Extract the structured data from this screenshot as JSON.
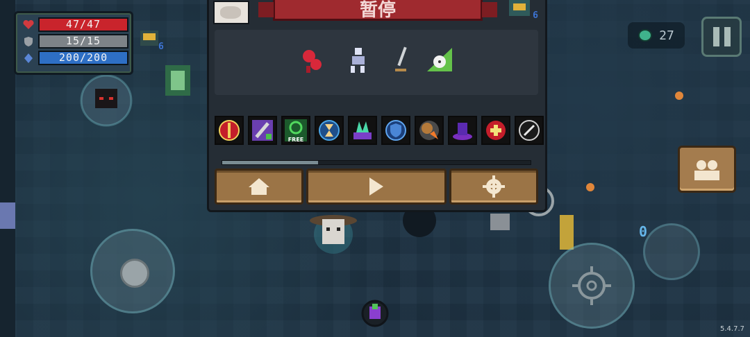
{
  "player": {
    "hp": "47/47",
    "armor": "15/15",
    "energy": "200/200",
    "hp_fraction": 1.0,
    "armor_fraction": 1.0,
    "energy_fraction": 1.0
  },
  "colors": {
    "hp": "#c9242c",
    "armor": "#7d8388",
    "energy": "#2e6fc5",
    "menu_bg": "#252d35",
    "banner": "#9f2a2f",
    "button": "#9b7446"
  },
  "gems": {
    "count": "27",
    "icon": "gem-icon"
  },
  "pause_menu": {
    "title": "暂停",
    "boss_count": "6",
    "buffs": [
      "red-serpent-buff",
      "skeleton-buff",
      "sword-buff",
      "clock-buff"
    ],
    "skills": [
      {
        "icon": "red-sword-icon"
      },
      {
        "icon": "purple-arrows-sword-icon"
      },
      {
        "icon": "free-refresh-icon",
        "label": "FREE"
      },
      {
        "icon": "hourglass-icon"
      },
      {
        "icon": "magic-book-icon"
      },
      {
        "icon": "blue-shield-icon"
      },
      {
        "icon": "fire-cannon-icon"
      },
      {
        "icon": "purple-portal-icon"
      },
      {
        "icon": "red-heart-plus-icon"
      },
      {
        "icon": "feather-icon"
      }
    ],
    "progress_fraction": 0.31,
    "buttons": {
      "home": "home-icon",
      "resume": "play-icon",
      "settings": "gear-icon"
    }
  },
  "map": {
    "enemy_count": "6"
  },
  "skill_charges": "0",
  "version": "5.4.7.7"
}
